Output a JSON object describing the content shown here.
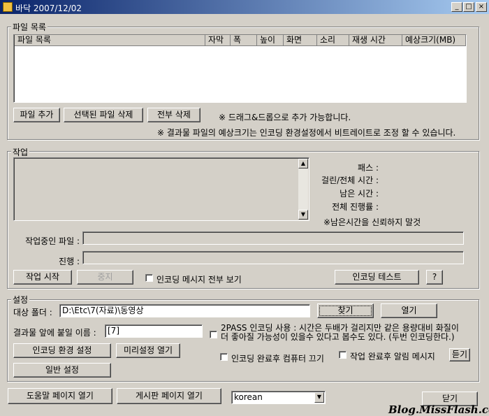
{
  "window": {
    "title": "바닥 2007/12/02",
    "minimize": "_",
    "maximize": "□",
    "close": "×"
  },
  "file_group": {
    "legend": "파일 목록",
    "columns": [
      "파일 목록",
      "자막",
      "폭",
      "높이",
      "화면",
      "소리",
      "재생 시간",
      "예상크기(MB)"
    ],
    "add_button": "파일 추가",
    "delete_selected_button": "선택된 파일 삭제",
    "delete_all_button": "전부 삭제",
    "drag_hint": "※ 드래그&드롭으로 추가 가능합니다.",
    "size_hint": "※ 결과물 파일의 예상크기는 인코딩 환경설정에서 비트레이트로 조정 할 수 있습니다."
  },
  "job_group": {
    "legend": "작업",
    "pass_label": "패스 :",
    "elapsed_label": "걸린/전체 시간 :",
    "remaining_label": "남은 시간 :",
    "progress_label": "전체 진행률 :",
    "remaining_note": "※남은시간을 신뢰하지 말것",
    "current_file_label": "작업중인 파일 :",
    "progress_row_label": "진행 :",
    "start_button": "작업 시작",
    "stop_button": "중지",
    "show_all_messages": "인코딩 메시지 전부 보기",
    "encode_test_button": "인코딩 테스트",
    "help_button": "?"
  },
  "settings_group": {
    "legend": "설정",
    "target_folder_label": "대상 폴더 :",
    "target_folder_value": "D:\\Etc\\7(자료)\\동영상",
    "browse_button": "찾기",
    "open_button": "열기",
    "prefix_label": "결과물 앞에 붙일 이름 :",
    "prefix_value": "[7]",
    "twopass_text_1": "2PASS 인코딩 사용 : 시간은 두배가 걸리지만 같은 용량대비 화질이",
    "twopass_text_2": "더 좋아질 가능성이 있을수 있다고 봅수도 있다. (두번 인코딩한다.)",
    "encode_env_button": "인코딩 환경 설정",
    "preset_button": "미리설정 열기",
    "general_button": "일반 설정",
    "shutdown_label": "인코딩 완료후 컴퓨터 끄기",
    "alert_label": "작업 완료후 알림 메시지",
    "listen_button": "듣기"
  },
  "footer": {
    "help_page_button": "도움말 페이지 열기",
    "board_page_button": "게시판 페이지 열기",
    "language_value": "korean",
    "close_button": "닫기",
    "watermark": "Blog.MissFlash.com"
  }
}
